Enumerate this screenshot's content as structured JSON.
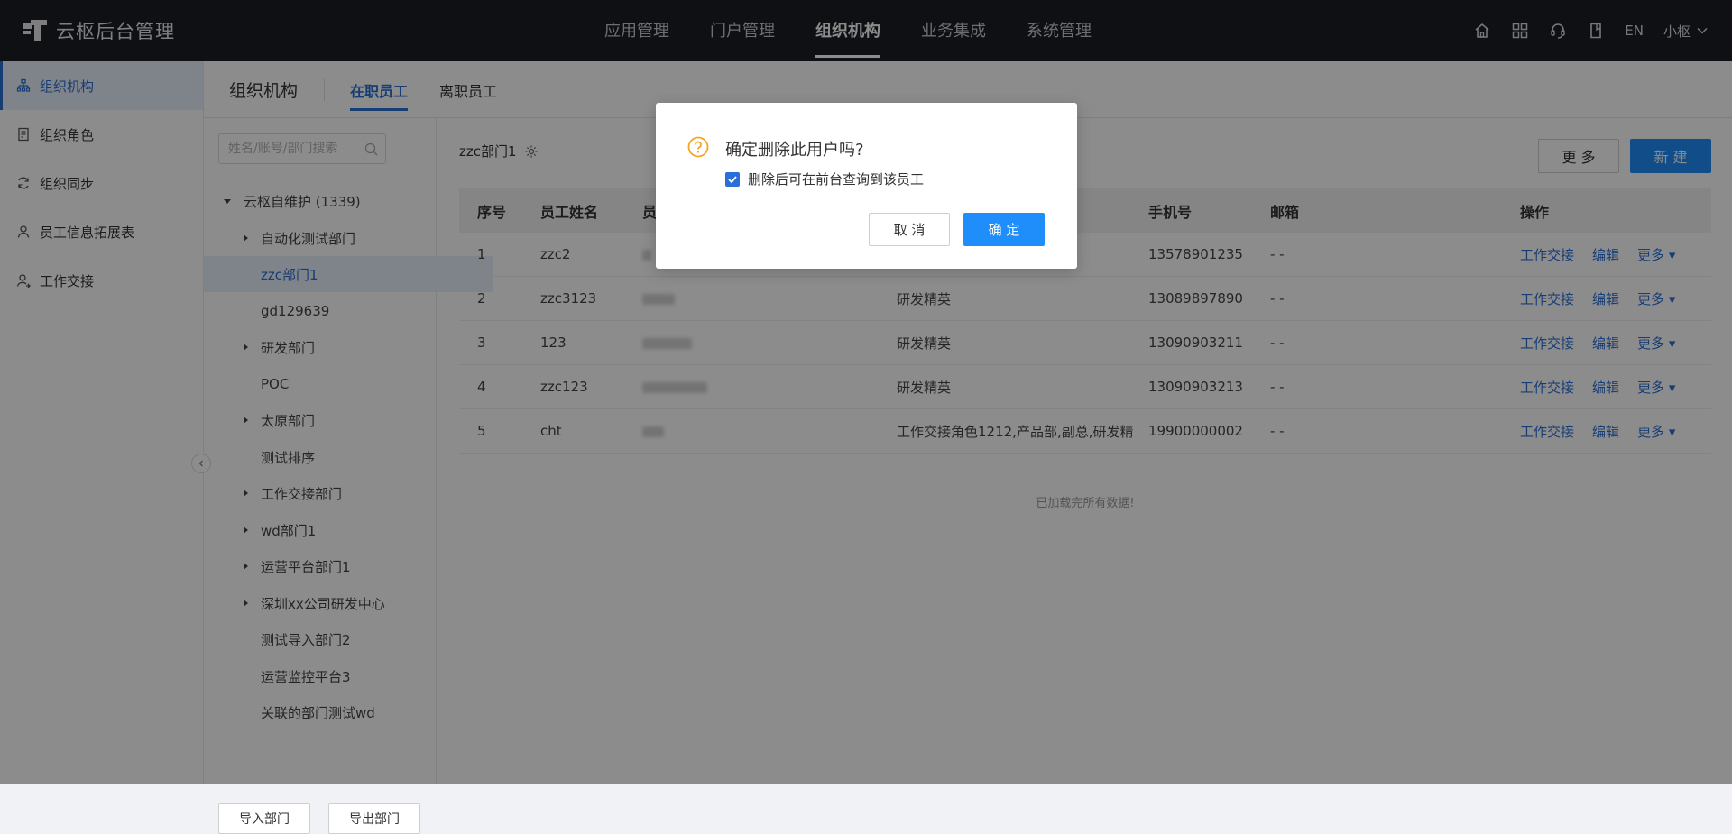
{
  "app": {
    "title": "云枢后台管理"
  },
  "nav": {
    "items": [
      "应用管理",
      "门户管理",
      "组织机构",
      "业务集成",
      "系统管理"
    ],
    "active": "组织机构"
  },
  "tools": {
    "lang": "EN",
    "user": "小枢"
  },
  "sidebar": {
    "items": [
      {
        "label": "组织机构",
        "icon": "org-tree-icon",
        "active": true
      },
      {
        "label": "组织角色",
        "icon": "role-icon"
      },
      {
        "label": "组织同步",
        "icon": "sync-icon"
      },
      {
        "label": "员工信息拓展表",
        "icon": "user-icon"
      },
      {
        "label": "工作交接",
        "icon": "handover-icon"
      }
    ]
  },
  "page": {
    "title": "组织机构",
    "tabs": [
      "在职员工",
      "离职员工"
    ],
    "active_tab": "在职员工"
  },
  "tree": {
    "search_placeholder": "姓名/账号/部门搜索",
    "root": "云枢自维护 (1339)",
    "nodes": [
      {
        "label": "自动化测试部门",
        "expandable": true
      },
      {
        "label": "zzc部门1",
        "expandable": false,
        "selected": true
      },
      {
        "label": "gd129639",
        "expandable": false
      },
      {
        "label": "研发部门",
        "expandable": true
      },
      {
        "label": "POC",
        "expandable": false
      },
      {
        "label": "太原部门",
        "expandable": true
      },
      {
        "label": "测试排序",
        "expandable": false
      },
      {
        "label": "工作交接部门",
        "expandable": true
      },
      {
        "label": "wd部门1",
        "expandable": true
      },
      {
        "label": "运营平台部门1",
        "expandable": true
      },
      {
        "label": "深圳xx公司研发中心",
        "expandable": true
      },
      {
        "label": "测试导入部门2",
        "expandable": false
      },
      {
        "label": "运营监控平台3",
        "expandable": false
      },
      {
        "label": "关联的部门测试wd",
        "expandable": false
      }
    ],
    "import_btn": "导入部门",
    "export_btn": "导出部门"
  },
  "content": {
    "dept": "zzc部门1",
    "more_btn": "更 多",
    "new_btn": "新 建",
    "columns": [
      "序号",
      "员工姓名",
      "员",
      "",
      "手机号",
      "邮箱",
      "操作"
    ],
    "rows": [
      {
        "no": "1",
        "name": "zzc2",
        "role": "",
        "phone": "13578901235",
        "email": "- -"
      },
      {
        "no": "2",
        "name": "zzc3123",
        "role": "研发精英",
        "phone": "13089897890",
        "email": "- -"
      },
      {
        "no": "3",
        "name": "123",
        "role": "研发精英",
        "phone": "13090903211",
        "email": "- -"
      },
      {
        "no": "4",
        "name": "zzc123",
        "role": "研发精英",
        "phone": "13090903213",
        "email": "- -"
      },
      {
        "no": "5",
        "name": "cht",
        "role": "工作交接角色1212,产品部,副总,研发精",
        "phone": "19900000002",
        "email": "- -"
      }
    ],
    "actions": [
      "工作交接",
      "编辑",
      "更多"
    ],
    "loaded_text": "已加载完所有数据!"
  },
  "dialog": {
    "title": "确定删除此用户吗?",
    "checkbox_label": "删除后可在前台查询到该员工",
    "checked": true,
    "cancel": "取 消",
    "confirm": "确 定"
  }
}
